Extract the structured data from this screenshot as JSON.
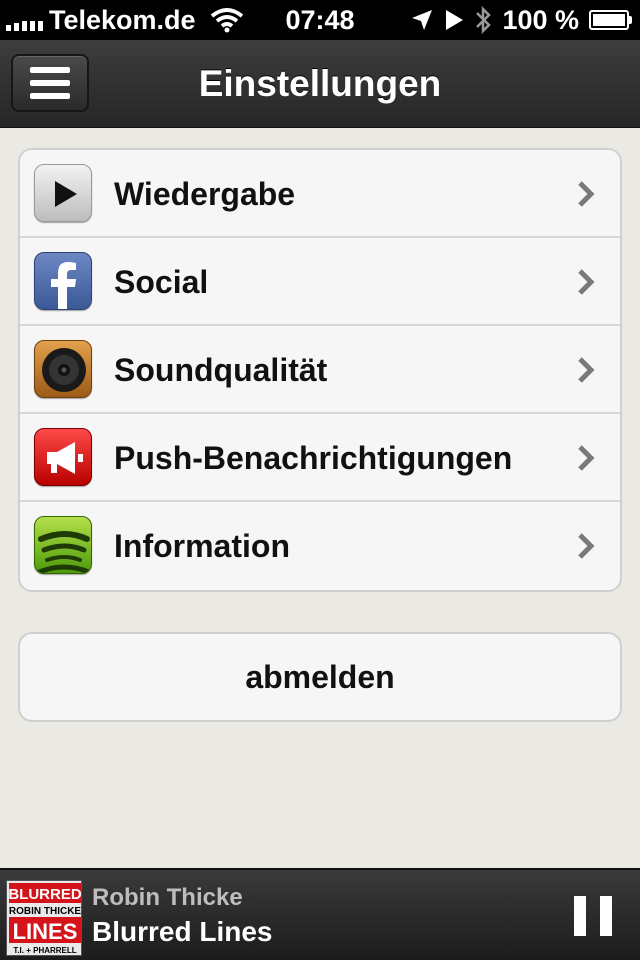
{
  "status_bar": {
    "carrier": "Telekom.de",
    "time": "07:48",
    "battery_percent": "100 %"
  },
  "nav": {
    "title": "Einstellungen"
  },
  "settings": {
    "items": [
      {
        "label": "Wiedergabe",
        "icon": "play-icon"
      },
      {
        "label": "Social",
        "icon": "facebook-icon"
      },
      {
        "label": "Soundqualität",
        "icon": "speaker-icon"
      },
      {
        "label": "Push-Benachrichtigungen",
        "icon": "megaphone-icon"
      },
      {
        "label": "Information",
        "icon": "spotify-icon"
      }
    ]
  },
  "logout": {
    "label": "abmelden"
  },
  "now_playing": {
    "artist": "Robin Thicke",
    "title": "Blurred Lines",
    "album_art_text": [
      "BLURRED",
      "ROBIN THICKE",
      "LINES",
      "T.I. + PHARRELL"
    ]
  },
  "colors": {
    "background": "#ebe9e4",
    "nav_bar": "#2e2e2e",
    "text": "#111111"
  }
}
